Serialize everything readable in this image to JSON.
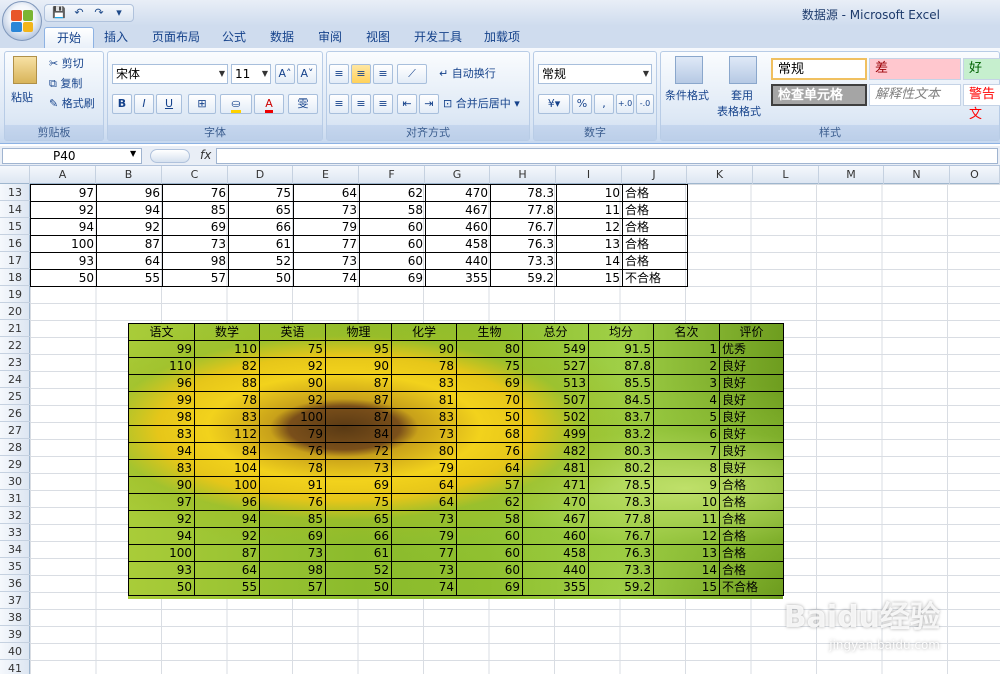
{
  "window": {
    "title": "数据源 - Microsoft Excel"
  },
  "qat": {
    "save": "💾",
    "undo": "↶",
    "redo": "↷",
    "more": "▾"
  },
  "tabs": [
    "开始",
    "插入",
    "页面布局",
    "公式",
    "数据",
    "审阅",
    "视图",
    "开发工具",
    "加载项"
  ],
  "ribbon": {
    "clipboard": {
      "paste": "粘贴",
      "cut": "剪切",
      "copy": "复制",
      "format_painter": "格式刷",
      "label": "剪贴板"
    },
    "font": {
      "name": "宋体",
      "size": "11",
      "grow": "A˄",
      "shrink": "A˅",
      "bold": "B",
      "italic": "I",
      "underline": "U",
      "wen": "雯",
      "label": "字体"
    },
    "alignment": {
      "wrap": "自动换行",
      "merge": "合并后居中",
      "label": "对齐方式"
    },
    "number": {
      "format": "常规",
      "percent": "%",
      "comma": ",",
      "inc_dec": ".0→.00",
      "dec_dec": ".00→.0",
      "label": "数字"
    },
    "styles": {
      "conditional": "条件格式",
      "table_format_1": "套用",
      "table_format_2": "表格格式",
      "normal": "常规",
      "bad": "差",
      "good": "好",
      "check_cell": "检查单元格",
      "explanatory": "解释性文本",
      "warning": "警告文",
      "label": "样式"
    }
  },
  "formula_bar": {
    "name_box": "P40",
    "fx": "fx",
    "value": ""
  },
  "columns": [
    "A",
    "B",
    "C",
    "D",
    "E",
    "F",
    "G",
    "H",
    "I",
    "J",
    "K",
    "L",
    "M",
    "N",
    "O"
  ],
  "rows": [
    "13",
    "14",
    "15",
    "16",
    "17",
    "18",
    "19",
    "20",
    "21",
    "22",
    "23",
    "24",
    "25",
    "26",
    "27",
    "28",
    "29",
    "30",
    "31",
    "32",
    "33",
    "34",
    "35",
    "36",
    "37",
    "38",
    "39",
    "40",
    "41"
  ],
  "top_table": [
    [
      "97",
      "96",
      "76",
      "75",
      "64",
      "62",
      "470",
      "78.3",
      "10",
      "合格"
    ],
    [
      "92",
      "94",
      "85",
      "65",
      "73",
      "58",
      "467",
      "77.8",
      "11",
      "合格"
    ],
    [
      "94",
      "92",
      "69",
      "66",
      "79",
      "60",
      "460",
      "76.7",
      "12",
      "合格"
    ],
    [
      "100",
      "87",
      "73",
      "61",
      "77",
      "60",
      "458",
      "76.3",
      "13",
      "合格"
    ],
    [
      "93",
      "64",
      "98",
      "52",
      "73",
      "60",
      "440",
      "73.3",
      "14",
      "合格"
    ],
    [
      "50",
      "55",
      "57",
      "50",
      "74",
      "69",
      "355",
      "59.2",
      "15",
      "不合格"
    ]
  ],
  "bottom_table": {
    "headers": [
      "语文",
      "数学",
      "英语",
      "物理",
      "化学",
      "生物",
      "总分",
      "均分",
      "名次",
      "评价"
    ],
    "rows": [
      [
        "99",
        "110",
        "75",
        "95",
        "90",
        "80",
        "549",
        "91.5",
        "1",
        "优秀"
      ],
      [
        "110",
        "82",
        "92",
        "90",
        "78",
        "75",
        "527",
        "87.8",
        "2",
        "良好"
      ],
      [
        "96",
        "88",
        "90",
        "87",
        "83",
        "69",
        "513",
        "85.5",
        "3",
        "良好"
      ],
      [
        "99",
        "78",
        "92",
        "87",
        "81",
        "70",
        "507",
        "84.5",
        "4",
        "良好"
      ],
      [
        "98",
        "83",
        "100",
        "87",
        "83",
        "50",
        "502",
        "83.7",
        "5",
        "良好"
      ],
      [
        "83",
        "112",
        "79",
        "84",
        "73",
        "68",
        "499",
        "83.2",
        "6",
        "良好"
      ],
      [
        "94",
        "84",
        "76",
        "72",
        "80",
        "76",
        "482",
        "80.3",
        "7",
        "良好"
      ],
      [
        "83",
        "104",
        "78",
        "73",
        "79",
        "64",
        "481",
        "80.2",
        "8",
        "良好"
      ],
      [
        "90",
        "100",
        "91",
        "69",
        "64",
        "57",
        "471",
        "78.5",
        "9",
        "合格"
      ],
      [
        "97",
        "96",
        "76",
        "75",
        "64",
        "62",
        "470",
        "78.3",
        "10",
        "合格"
      ],
      [
        "92",
        "94",
        "85",
        "65",
        "73",
        "58",
        "467",
        "77.8",
        "11",
        "合格"
      ],
      [
        "94",
        "92",
        "69",
        "66",
        "79",
        "60",
        "460",
        "76.7",
        "12",
        "合格"
      ],
      [
        "100",
        "87",
        "73",
        "61",
        "77",
        "60",
        "458",
        "76.3",
        "13",
        "合格"
      ],
      [
        "93",
        "64",
        "98",
        "52",
        "73",
        "60",
        "440",
        "73.3",
        "14",
        "合格"
      ],
      [
        "50",
        "55",
        "57",
        "50",
        "74",
        "69",
        "355",
        "59.2",
        "15",
        "不合格"
      ]
    ]
  },
  "watermark": {
    "main": "Baidu经验",
    "sub": "jingyan.baidu.com"
  }
}
